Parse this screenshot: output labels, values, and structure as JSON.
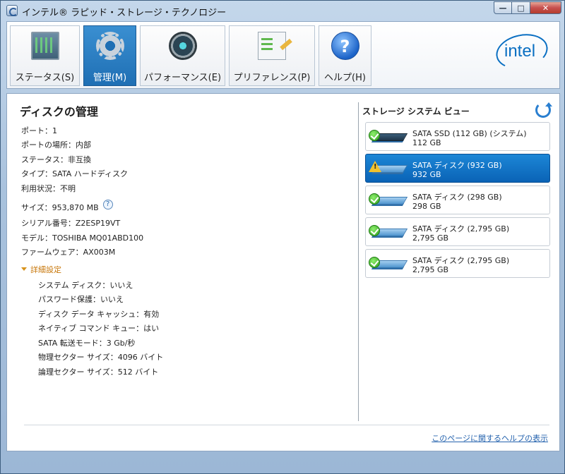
{
  "window": {
    "title": "インテル® ラピッド・ストレージ・テクノロジー",
    "min_label": "—",
    "max_label": "□",
    "close_label": "✕"
  },
  "toolbar": {
    "tabs": [
      {
        "label": "ステータス(S)",
        "icon": "status-monitor-icon"
      },
      {
        "label": "管理(M)",
        "icon": "gear-icon",
        "active": true
      },
      {
        "label": "パフォーマンス(E)",
        "icon": "performance-gauge-icon"
      },
      {
        "label": "プリファレンス(P)",
        "icon": "preferences-clipboard-icon"
      },
      {
        "label": "ヘルプ(H)",
        "icon": "help-icon"
      }
    ],
    "logo_text": "intel"
  },
  "disk_management": {
    "heading": "ディスクの管理",
    "properties": [
      "ポート：1",
      "ポートの場所：内部",
      "ステータス：非互換",
      "タイプ：SATA ハードディスク",
      "利用状況：不明",
      "サイズ：953,870 MB",
      "シリアル番号：Z2ESP19VT",
      "モデル：TOSHIBA MQ01ABD100",
      "ファームウェア：AX003M"
    ],
    "advanced_label": "詳細設定",
    "advanced": [
      "システム ディスク：いいえ",
      "パスワード保護：いいえ",
      "ディスク データ キャッシュ：有効",
      "ネイティブ コマンド キュー：はい",
      "SATA 転送モード：3 Gb/秒",
      "物理セクター サイズ：4096 バイト",
      "論理セクター サイズ：512 バイト"
    ],
    "info_glyph": "?"
  },
  "storage_view": {
    "title": "ストレージ システム ビュー",
    "disks": [
      {
        "name": "SATA SSD (112 GB) (システム)",
        "size": "112 GB",
        "status": "ok",
        "kind": "ssd"
      },
      {
        "name": "SATA ディスク (932 GB)",
        "size": "932 GB",
        "status": "warning",
        "kind": "hdd",
        "selected": true
      },
      {
        "name": "SATA ディスク (298 GB)",
        "size": "298 GB",
        "status": "ok",
        "kind": "hdd"
      },
      {
        "name": "SATA ディスク (2,795 GB)",
        "size": "2,795 GB",
        "status": "ok",
        "kind": "hdd"
      },
      {
        "name": "SATA ディスク (2,795 GB)",
        "size": "2,795 GB",
        "status": "ok",
        "kind": "hdd"
      }
    ]
  },
  "footer": {
    "help_link": "このページに関するヘルプの表示"
  }
}
